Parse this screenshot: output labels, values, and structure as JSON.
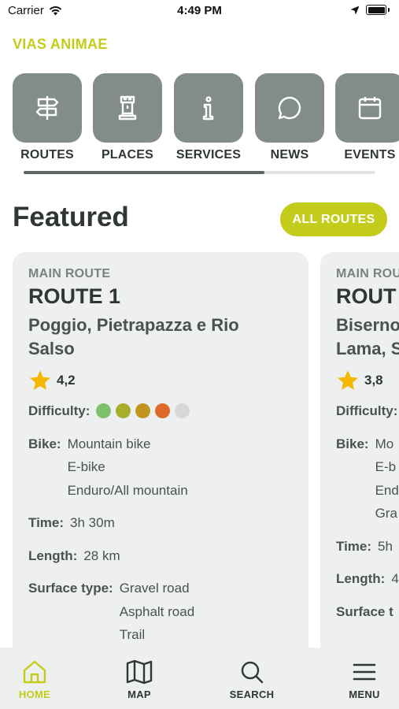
{
  "status_bar": {
    "carrier": "Carrier",
    "time": "4:49 PM"
  },
  "app": {
    "brand": "VIAS ANIMAE",
    "accent_color": "#c3cc1a",
    "tile_color": "#838d88"
  },
  "categories": [
    {
      "label": "ROUTES",
      "icon": "signpost-icon"
    },
    {
      "label": "PLACES",
      "icon": "tower-icon"
    },
    {
      "label": "SERVICES",
      "icon": "info-icon"
    },
    {
      "label": "NEWS",
      "icon": "chat-bubble-icon"
    },
    {
      "label": "EVENTS",
      "icon": "calendar-icon"
    }
  ],
  "featured": {
    "title": "Featured",
    "all_routes_label": "ALL ROUTES"
  },
  "cards": [
    {
      "type": "MAIN ROUTE",
      "title": "ROUTE 1",
      "subtitle_line1": "Poggio, Pietrapazza e Rio",
      "subtitle_line2": "Salso",
      "rating": "4,2",
      "difficulty_label": "Difficulty:",
      "difficulty_colors": [
        "#7dc16b",
        "#a8ad2c",
        "#c2961e",
        "#dd6a2a",
        "#d7d9d8"
      ],
      "bike_label": "Bike:",
      "bikes": [
        "Mountain bike",
        "E-bike",
        "Enduro/All mountain"
      ],
      "time_label": "Time:",
      "time": "3h 30m",
      "length_label": "Length:",
      "length": "28 km",
      "surface_label": "Surface type:",
      "surfaces": [
        "Gravel road",
        "Asphalt road",
        "Trail"
      ]
    },
    {
      "type": "MAIN ROU",
      "title": "ROUT",
      "subtitle_line1": "Biserno",
      "subtitle_line2": "Lama, S",
      "rating": "3,8",
      "difficulty_label": "Difficulty:",
      "bike_label": "Bike:",
      "bikes": [
        "Mo",
        "E-b",
        "End",
        "Gra"
      ],
      "time_label": "Time:",
      "time": "5h",
      "length_label": "Length:",
      "length": "4",
      "surface_label": "Surface t"
    }
  ],
  "tabs": [
    {
      "label": "HOME",
      "icon": "home-icon",
      "active": true
    },
    {
      "label": "MAP",
      "icon": "map-icon"
    },
    {
      "label": "SEARCH",
      "icon": "search-icon"
    },
    {
      "label": "MENU",
      "icon": "menu-icon"
    }
  ]
}
